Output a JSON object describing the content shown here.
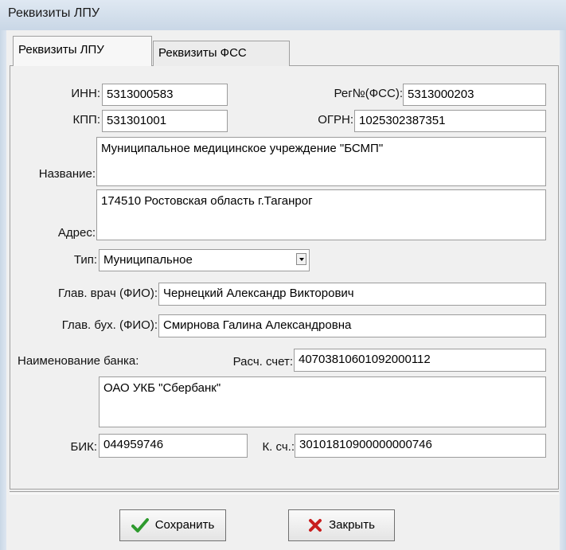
{
  "window": {
    "title": "Реквизиты ЛПУ"
  },
  "tabs": [
    {
      "label": "Реквизиты ЛПУ",
      "active": true
    },
    {
      "label": "Реквизиты ФСС",
      "active": false
    }
  ],
  "form": {
    "inn": {
      "label": "ИНН:",
      "value": "5313000583"
    },
    "reg_fss": {
      "label": "Рег№(ФСС):",
      "value": "5313000203"
    },
    "kpp": {
      "label": "КПП:",
      "value": "531301001"
    },
    "ogrn": {
      "label": "ОГРН:",
      "value": "1025302387351"
    },
    "name": {
      "label": "Название:",
      "value": "Муниципальное медицинское учреждение \"БСМП\""
    },
    "address": {
      "label": "Адрес:",
      "value": "174510 Ростовская область г.Таганрог"
    },
    "type": {
      "label": "Тип:",
      "value": "Муниципальное"
    },
    "chief_doctor": {
      "label": "Глав. врач (ФИО):",
      "value": "Чернецкий Александр Викторович"
    },
    "chief_accountant": {
      "label": "Глав. бух. (ФИО):",
      "value": "Смирнова Галина Александровна"
    },
    "bank_name": {
      "label": "Наименование банка:",
      "value": "ОАО УКБ \"Сбербанк\""
    },
    "account": {
      "label": "Расч. счет:",
      "value": "40703810601092000112"
    },
    "bik": {
      "label": "БИК:",
      "value": "044959746"
    },
    "corr_account": {
      "label": "К. сч.:",
      "value": "30101810900000000746"
    }
  },
  "buttons": {
    "save": {
      "label": "Сохранить",
      "icon": "checkmark-icon",
      "color": "#2e9a2e"
    },
    "close": {
      "label": "Закрыть",
      "icon": "x-icon",
      "color": "#c81e1e"
    }
  }
}
